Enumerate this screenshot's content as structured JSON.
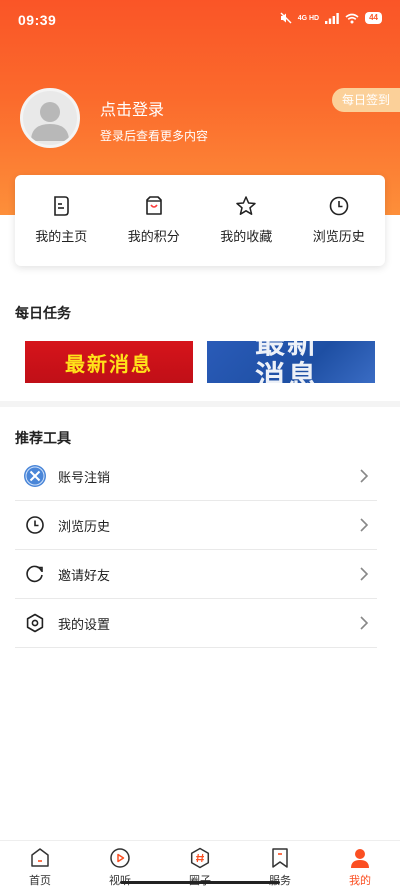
{
  "status_bar": {
    "time": "09:39",
    "network": "4G HD",
    "battery": "44"
  },
  "profile": {
    "login_title": "点击登录",
    "login_subtitle": "登录后查看更多内容",
    "daily_checkin": "每日签到"
  },
  "quick_links": [
    {
      "label": "我的主页",
      "icon": "homepage-icon"
    },
    {
      "label": "我的积分",
      "icon": "shopping-bag-icon"
    },
    {
      "label": "我的收藏",
      "icon": "star-icon"
    },
    {
      "label": "浏览历史",
      "icon": "clock-icon"
    }
  ],
  "daily_tasks": {
    "title": "每日任务",
    "banners": [
      {
        "text": "最新消息"
      },
      {
        "text": "最新\n消息"
      }
    ]
  },
  "tools": {
    "title": "推荐工具",
    "items": [
      {
        "label": "账号注销",
        "icon": "close-circle-icon"
      },
      {
        "label": "浏览历史",
        "icon": "clock-icon"
      },
      {
        "label": "邀请好友",
        "icon": "refresh-icon"
      },
      {
        "label": "我的设置",
        "icon": "settings-hexagon-icon"
      }
    ]
  },
  "tabbar": {
    "items": [
      {
        "label": "首页",
        "icon": "home-icon"
      },
      {
        "label": "视听",
        "icon": "play-icon"
      },
      {
        "label": "圈子",
        "icon": "hashtag-icon"
      },
      {
        "label": "服务",
        "icon": "bookmark-icon"
      },
      {
        "label": "我的",
        "icon": "user-icon",
        "active": true
      }
    ]
  },
  "colors": {
    "brand_orange": "#fb5a2a",
    "active_tab": "#fb4f22",
    "checkin_bg": "#fbd099"
  }
}
